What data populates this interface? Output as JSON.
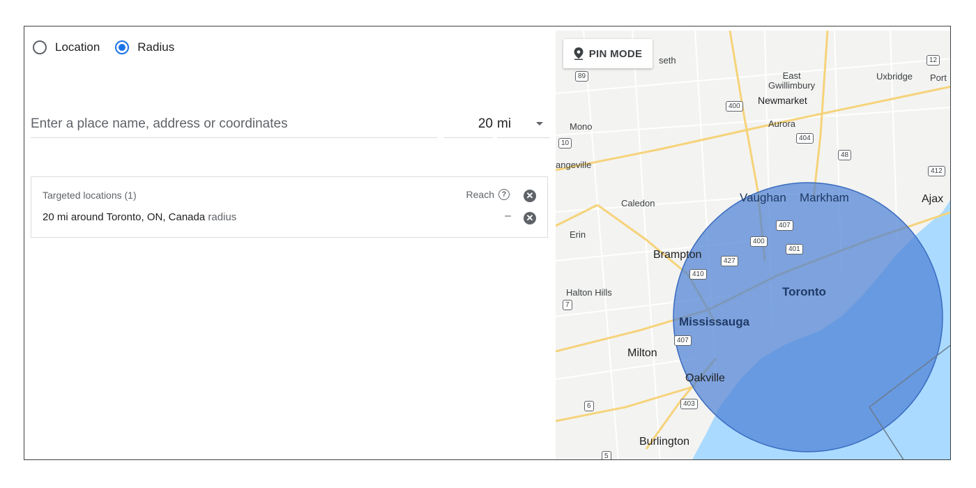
{
  "mode": {
    "location_label": "Location",
    "radius_label": "Radius",
    "selected": "radius"
  },
  "search": {
    "placeholder": "Enter a place name, address or coordinates",
    "value": ""
  },
  "radius": {
    "value": "20",
    "unit": "mi"
  },
  "targets": {
    "header": "Targeted locations (1)",
    "reach_label": "Reach",
    "items": [
      {
        "text": "20 mi around Toronto, ON, Canada",
        "suffix": "radius",
        "reach": "–"
      }
    ]
  },
  "map": {
    "pin_mode_label": "PIN MODE",
    "labels": {
      "newmarket": "Newmarket",
      "east_gwillimbury": "East\nGwillimbury",
      "uxbridge": "Uxbridge",
      "port": "Port",
      "mono": "Mono",
      "aurora": "Aurora",
      "orangeville": "angeville",
      "caledon": "Caledon",
      "vaughan": "Vaughan",
      "markham": "Markham",
      "ajax": "Ajax",
      "erin": "Erin",
      "brampton": "Brampton",
      "halton_hills": "Halton Hills",
      "toronto": "Toronto",
      "mississauga": "Mississauga",
      "milton": "Milton",
      "oakville": "Oakville",
      "burlington": "Burlington",
      "seth": "seth"
    },
    "shields": {
      "s89": "89",
      "s400a": "400",
      "s404": "404",
      "s48": "48",
      "s12": "12",
      "s412": "412",
      "s10": "10",
      "s407": "407",
      "s400b": "400",
      "s401": "401",
      "s427": "427",
      "s410": "410",
      "s7": "7",
      "s407b": "407",
      "s403": "403",
      "s6": "6",
      "s5": "5"
    },
    "colors": {
      "water": "#aadaff",
      "land": "#f3f3f1",
      "radius_fill": "#4a7fd4",
      "highway": "#f6d37a"
    }
  }
}
